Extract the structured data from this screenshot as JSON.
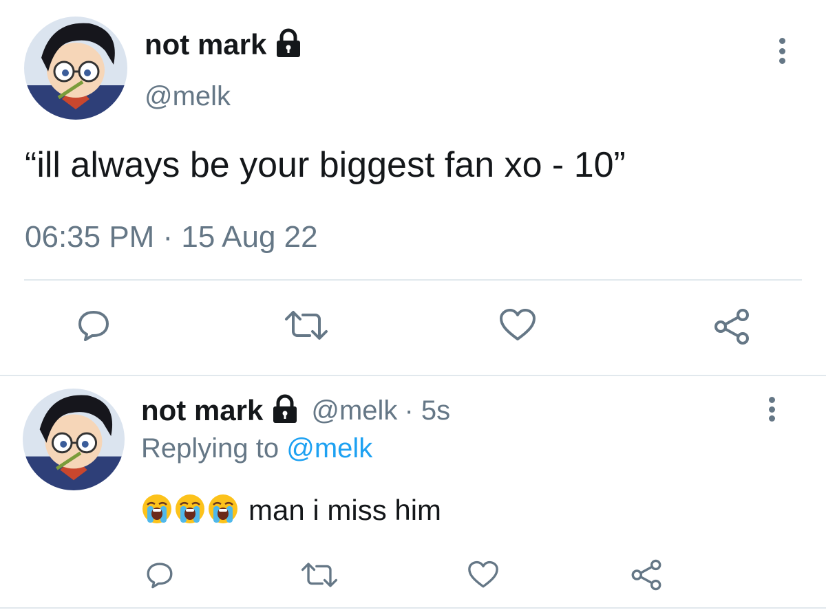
{
  "tweet": {
    "display_name": "not mark",
    "handle": "@melk",
    "text": "“ill always be your biggest fan xo - 10”",
    "timestamp": "06:35 PM · 15 Aug 22",
    "icons": {
      "lock": "lock-icon",
      "more": "more-options-icon",
      "reply": "reply-icon",
      "retweet": "retweet-icon",
      "like": "heart-icon",
      "share": "share-icon"
    }
  },
  "reply": {
    "display_name": "not mark",
    "handle": "@melk",
    "age": "· 5s",
    "replying_prefix": "Replying to",
    "replying_to": "@melk",
    "emojis": [
      "loudly-crying-face",
      "loudly-crying-face",
      "loudly-crying-face"
    ],
    "text": "man i miss him"
  },
  "colors": {
    "text": "#14171a",
    "secondary": "#657786",
    "link": "#1da1f2",
    "divider": "#e1e8ed"
  }
}
